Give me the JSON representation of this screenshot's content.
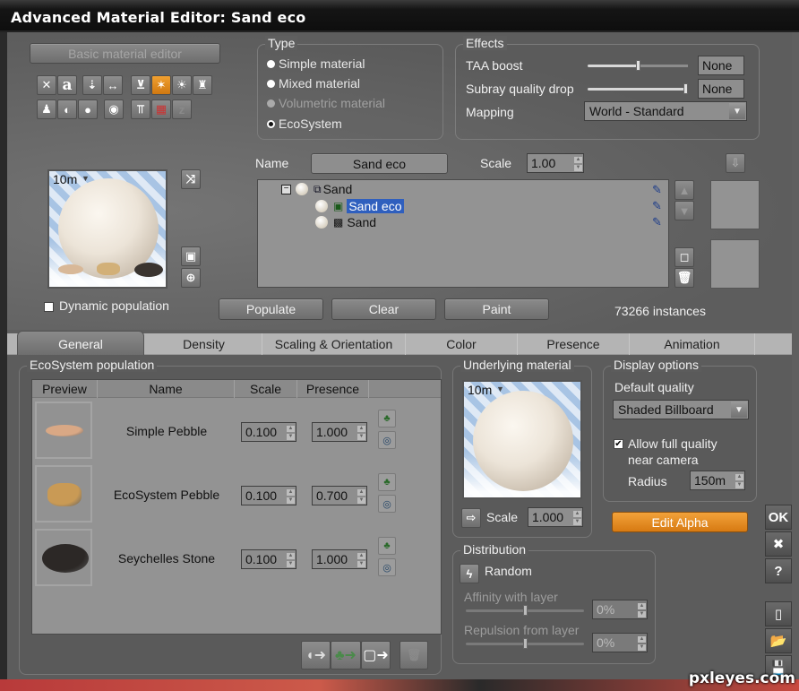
{
  "window": {
    "title": "Advanced Material Editor: Sand eco"
  },
  "left_toolbar": {
    "basic_editor_label": "Basic material editor",
    "row1_icons": [
      "shuffle-icon",
      "text-icon",
      "align-down-icon",
      "width-icon",
      "terrain-slope-icon",
      "eco-paint-icon",
      "light-icon",
      "figure-icon"
    ],
    "row2_icons": [
      "person-icon",
      "sphere-shading-icon",
      "object-icon",
      "render-icon",
      "stats-icon",
      "delete-clip-icon",
      "sleep-icon"
    ],
    "active_icon": "eco-paint-icon"
  },
  "type": {
    "legend": "Type",
    "options": [
      {
        "label": "Simple material",
        "state": "enabled"
      },
      {
        "label": "Mixed material",
        "state": "enabled"
      },
      {
        "label": "Volumetric material",
        "state": "disabled"
      },
      {
        "label": "EcoSystem",
        "state": "selected"
      }
    ]
  },
  "effects": {
    "legend": "Effects",
    "taa_label": "TAA boost",
    "taa_value": "None",
    "taa_slider": 0.5,
    "subray_label": "Subray quality drop",
    "subray_value": "None",
    "subray_slider": 1.0,
    "mapping_label": "Mapping",
    "mapping_value": "World - Standard"
  },
  "preview": {
    "distance": "10m",
    "dynamic_population_label": "Dynamic population",
    "dynamic_population_checked": false
  },
  "name_row": {
    "name_label": "Name",
    "name_value": "Sand eco",
    "scale_label": "Scale",
    "scale_value": "1.00"
  },
  "tree": {
    "items": [
      {
        "label": "Sand",
        "level": 0
      },
      {
        "label": "Sand eco",
        "level": 1,
        "selected": true
      },
      {
        "label": "Sand",
        "level": 1
      }
    ]
  },
  "actions": {
    "populate": "Populate",
    "clear": "Clear",
    "paint": "Paint",
    "instances": "73266 instances"
  },
  "tabs": [
    "General",
    "Density",
    "Scaling & Orientation",
    "Color",
    "Presence",
    "Animation"
  ],
  "active_tab": "General",
  "ecosystem": {
    "legend": "EcoSystem population",
    "columns": [
      "Preview",
      "Name",
      "Scale",
      "Presence"
    ],
    "rows": [
      {
        "name": "Simple Pebble",
        "scale": "0.100",
        "presence": "1.000",
        "color": "#d9a885"
      },
      {
        "name": "EcoSystem Pebble",
        "scale": "0.100",
        "presence": "0.700",
        "color": "#c99a55"
      },
      {
        "name": "Seychelles Stone",
        "scale": "0.100",
        "presence": "1.000",
        "color": "#2c2826"
      }
    ]
  },
  "underlying": {
    "legend": "Underlying material",
    "distance": "10m",
    "scale_label": "Scale",
    "scale_value": "1.000"
  },
  "display": {
    "legend": "Display options",
    "default_quality_label": "Default quality",
    "default_quality_value": "Shaded Billboard",
    "allow_full_label_1": "Allow full quality",
    "allow_full_label_2": "near camera",
    "allow_full_checked": true,
    "radius_label": "Radius",
    "radius_value": "150m"
  },
  "edit_alpha": "Edit Alpha",
  "distribution": {
    "legend": "Distribution",
    "mode": "Random",
    "affinity_label": "Affinity with layer",
    "affinity_value": "0%",
    "affinity_slider": 0.5,
    "repulsion_label": "Repulsion from layer",
    "repulsion_value": "0%",
    "repulsion_slider": 0.5
  },
  "side_buttons": {
    "ok": "OK",
    "cancel": "✖",
    "help": "?"
  },
  "watermark": "pxleyes.com",
  "colors": {
    "accent_orange": "#e08a20",
    "selection_blue": "#2f5fbe"
  }
}
